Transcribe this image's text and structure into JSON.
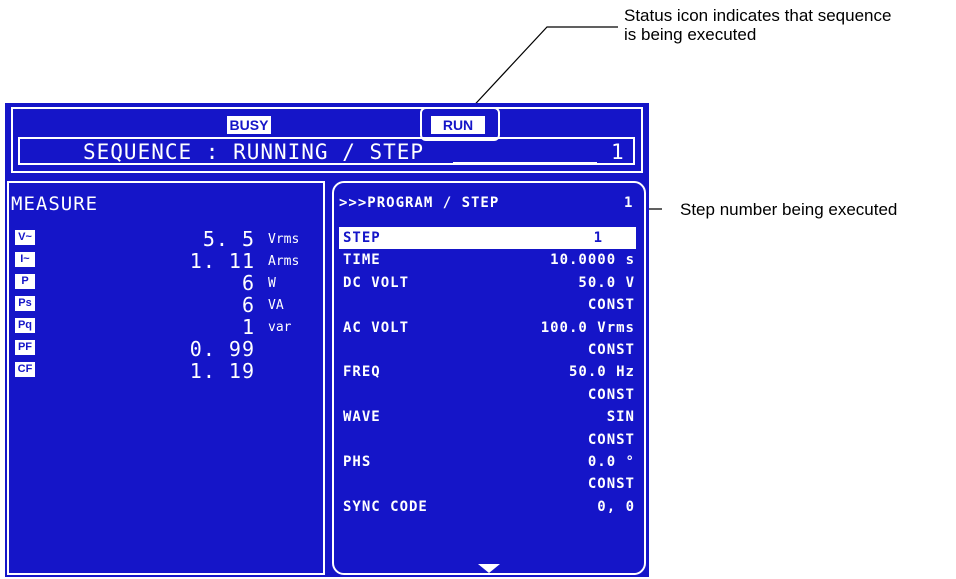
{
  "annotations": {
    "status_icon_line1": "Status icon indicates that sequence",
    "status_icon_line2": "is being executed",
    "step_number": "Step number being executed"
  },
  "status_bar": {
    "busy": "BUSY",
    "run": "RUN",
    "sequence_text": "SEQUENCE : RUNNING / STEP",
    "step": "1"
  },
  "measure": {
    "title": "MEASURE",
    "rows": [
      {
        "icon": "V~",
        "value": "5. 5",
        "unit": "Vrms"
      },
      {
        "icon": "I~",
        "value": "1. 11",
        "unit": "Arms"
      },
      {
        "icon": "P",
        "value": "6",
        "unit": "W"
      },
      {
        "icon": "Ps",
        "value": "6",
        "unit": "VA"
      },
      {
        "icon": "Pq",
        "value": "1",
        "unit": "var"
      },
      {
        "icon": "PF",
        "value": "0. 99",
        "unit": ""
      },
      {
        "icon": "CF",
        "value": "1. 19",
        "unit": ""
      }
    ]
  },
  "program": {
    "title": ">>>PROGRAM / STEP",
    "title_step": "1",
    "rows": [
      {
        "label": "STEP",
        "value": "1"
      },
      {
        "label": "TIME",
        "value": "10.0000 s"
      },
      {
        "label": "DC VOLT",
        "value": "50.0 V"
      },
      {
        "label": "",
        "value": "CONST"
      },
      {
        "label": "AC VOLT",
        "value": "100.0 Vrms"
      },
      {
        "label": "",
        "value": "CONST"
      },
      {
        "label": "FREQ",
        "value": "50.0 Hz"
      },
      {
        "label": "",
        "value": "CONST"
      },
      {
        "label": "WAVE",
        "value": "SIN"
      },
      {
        "label": "",
        "value": "CONST"
      },
      {
        "label": "PHS",
        "value": "0.0 °"
      },
      {
        "label": "",
        "value": "CONST"
      },
      {
        "label": "SYNC CODE",
        "value": "0, 0"
      }
    ]
  },
  "colors": {
    "lcd_blue": "#1515c8",
    "lcd_text": "#ffffff"
  }
}
